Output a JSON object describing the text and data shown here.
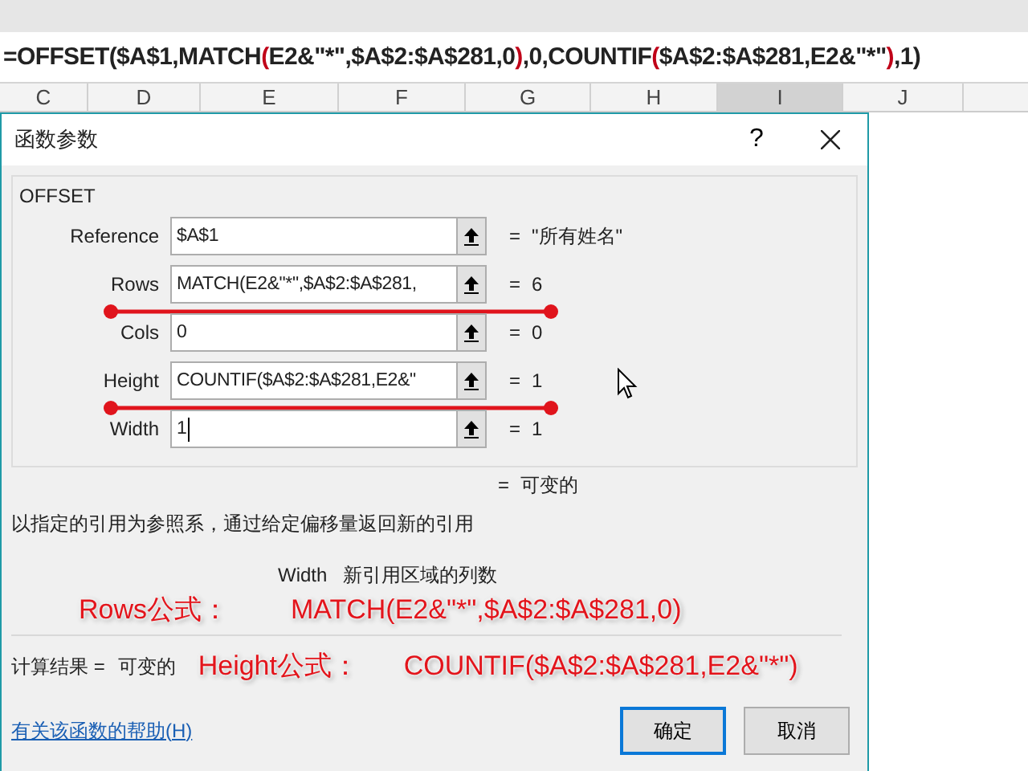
{
  "formula_bar": {
    "segments": [
      {
        "text": "=OFFSET($A$1,MATCH",
        "highlight": false
      },
      {
        "text": "(",
        "highlight": true
      },
      {
        "text": "E2&\"*\",$A$2:$A$281,0",
        "highlight": false
      },
      {
        "text": ")",
        "highlight": true
      },
      {
        "text": ",0,COUNTIF",
        "highlight": false
      },
      {
        "text": "(",
        "highlight": true
      },
      {
        "text": "$A$2:$A$281,E2&\"*\"",
        "highlight": false
      },
      {
        "text": ")",
        "highlight": true
      },
      {
        "text": ",1)",
        "highlight": false
      }
    ]
  },
  "column_headers": [
    {
      "label": "C",
      "selected": false
    },
    {
      "label": "D",
      "selected": false
    },
    {
      "label": "E",
      "selected": false
    },
    {
      "label": "F",
      "selected": false
    },
    {
      "label": "G",
      "selected": false
    },
    {
      "label": "H",
      "selected": false
    },
    {
      "label": "I",
      "selected": true
    },
    {
      "label": "J",
      "selected": false
    }
  ],
  "dialog": {
    "title": "函数参数",
    "help_button": "?",
    "function_name": "OFFSET",
    "arguments": [
      {
        "label": "Reference",
        "value": "$A$1",
        "equals": "=",
        "result": "\"所有姓名\"",
        "underlined": false,
        "focused": false
      },
      {
        "label": "Rows",
        "value": "MATCH(E2&\"*\",$A$2:$A$281,",
        "equals": "=",
        "result": "6",
        "underlined": true,
        "focused": false
      },
      {
        "label": "Cols",
        "value": "0",
        "equals": "=",
        "result": "0",
        "underlined": false,
        "focused": false
      },
      {
        "label": "Height",
        "value": "COUNTIF($A$2:$A$281,E2&\"",
        "equals": "=",
        "result": "1",
        "underlined": true,
        "focused": false
      },
      {
        "label": "Width",
        "value": "1",
        "equals": "=",
        "result": "1",
        "underlined": false,
        "focused": true
      }
    ],
    "formula_result": {
      "equals": "=",
      "value": "可变的"
    },
    "description": "以指定的引用为参照系，通过给定偏移量返回新的引用",
    "argument_help": {
      "name": "Width",
      "text": "新引用区域的列数"
    },
    "calc_result": {
      "label": "计算结果 =",
      "value": "可变的"
    },
    "help_link": "有关该函数的帮助(H)",
    "buttons": [
      {
        "label": "确定",
        "default": true
      },
      {
        "label": "取消",
        "default": false
      }
    ]
  },
  "annotations": [
    {
      "label": "Rows公式：",
      "formula": "MATCH(E2&\"*\",$A$2:$A$281,0)"
    },
    {
      "label": "Height公式：",
      "formula": "COUNTIF($A$2:$A$281,E2&\"*\")"
    }
  ]
}
